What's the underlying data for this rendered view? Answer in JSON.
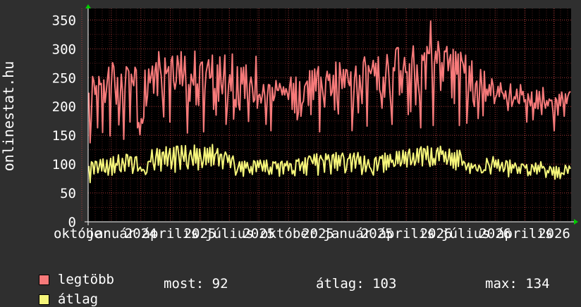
{
  "colors": {
    "background": "#2f2f2f",
    "plot_background": "#000000",
    "grid": "#b43c3c",
    "legtobb": "#f77a7a",
    "atlag": "#f5f57a",
    "axis_arrow": "#00cc00"
  },
  "chart_data": {
    "type": "line",
    "ylabel": "onlinestat.hu",
    "ylim": [
      0,
      370
    ],
    "yticks": [
      0,
      50,
      100,
      150,
      200,
      250,
      300,
      350
    ],
    "x_tick_labels": [
      "október",
      "január",
      "2024",
      "április",
      "2025",
      "július",
      "2025",
      "október",
      "2025",
      "január",
      "2025",
      "április",
      "2026",
      "július",
      "2026",
      "április",
      "2026"
    ],
    "grid": true,
    "series": [
      {
        "name": "legtöbb",
        "values": [
          224,
          137,
          181,
          252,
          244,
          221,
          236,
          163,
          252,
          238,
          240,
          155,
          246,
          207,
          227,
          249,
          268,
          149,
          235,
          276,
          269,
          233,
          204,
          250,
          168,
          205,
          256,
          225,
          143,
          230,
          269,
          266,
          261,
          173,
          256,
          244,
          236,
          268,
          263,
          163,
          172,
          151,
          179,
          171,
          182,
          263,
          201,
          219,
          265,
          241,
          254,
          270,
          223,
          262,
          276,
          219,
          295,
          269,
          254,
          217,
          182,
          284,
          257,
          262,
          269,
          173,
          279,
          287,
          244,
          230,
          244,
          288,
          271,
          239,
          295,
          236,
          257,
          287,
          229,
          154,
          238,
          209,
          256,
          245,
          237,
          296,
          203,
          239,
          202,
          270,
          276,
          277,
          156,
          228,
          259,
          271,
          281,
          249,
          251,
          289,
          195,
          231,
          185,
          272,
          209,
          286,
          239,
          222,
          253,
          289,
          169,
          200,
          237,
          255,
          227,
          291,
          178,
          212,
          199,
          269,
          204,
          194,
          267,
          239,
          268,
          214,
          272,
          224,
          174,
          239,
          251,
          234,
          208,
          212,
          287,
          197,
          219,
          221,
          206,
          219,
          238,
          219,
          169,
          214,
          238,
          237,
          158,
          233,
          210,
          218,
          245,
          228,
          228,
          240,
          231,
          220,
          234,
          220,
          231,
          224,
          212,
          235,
          251,
          195,
          240,
          189,
          251,
          177,
          190,
          243,
          183,
          205,
          209,
          235,
          240,
          244,
          202,
          262,
          186,
          262,
          212,
          265,
          227,
          259,
          269,
          156,
          251,
          233,
          216,
          199,
          247,
          261,
          245,
          256,
          219,
          225,
          254,
          194,
          277,
          211,
          187,
          276,
          255,
          231,
          264,
          233,
          264,
          263,
          243,
          236,
          260,
          158,
          203,
          249,
          270,
          228,
          189,
          254,
          231,
          205,
          277,
          286,
          267,
          166,
          271,
          262,
          257,
          267,
          280,
          253,
          275,
          229,
          286,
          229,
          221,
          197,
          251,
          216,
          255,
          290,
          270,
          235,
          205,
          169,
          267,
          262,
          298,
          302,
          302,
          220,
          262,
          224,
          266,
          285,
          259,
          260,
          186,
          274,
          191,
          282,
          305,
          261,
          203,
          272,
          240,
          218,
          163,
          289,
          280,
          293,
          230,
          304,
          292,
          292,
          348,
          270,
          167,
          273,
          296,
          275,
          313,
          293,
          228,
          276,
          244,
          296,
          295,
          304,
          262,
          281,
          290,
          215,
          299,
          205,
          295,
          256,
          291,
          167,
          294,
          280,
          274,
          258,
          289,
          171,
          216,
          270,
          227,
          279,
          210,
          200,
          239,
          244,
          179,
          216,
          264,
          235,
          184,
          261,
          209,
          230,
          219,
          238,
          219,
          248,
          237,
          205,
          215,
          221,
          235,
          217,
          241,
          225,
          222,
          213,
          227,
          211,
          193,
          219,
          239,
          200,
          208,
          217,
          213,
          230,
          208,
          205,
          238,
          220,
          226,
          208,
          212,
          173,
          222,
          211,
          201,
          225,
          177,
          206,
          197,
          228,
          196,
          226,
          207,
          186,
          233,
          208,
          197,
          210,
          201,
          213,
          210,
          211,
          192,
          158,
          215,
          211,
          185,
          221,
          201,
          225,
          211,
          183,
          222,
          205,
          218,
          224,
          226
        ],
        "color": "#f77a7a"
      },
      {
        "name": "átlag",
        "values": [
          97,
          68,
          104,
          102,
          83,
          105,
          104,
          85,
          95,
          108,
          88,
          109,
          88,
          86,
          107,
          81,
          95,
          110,
          81,
          113,
          85,
          101,
          98,
          116,
          90,
          87,
          110,
          101,
          88,
          117,
          116,
          96,
          113,
          112,
          84,
          94,
          112,
          113,
          88,
          92,
          95,
          88,
          91,
          89,
          82,
          86,
          104,
          105,
          104,
          125,
          102,
          90,
          112,
          127,
          98,
          125,
          88,
          120,
          121,
          100,
          130,
          97,
          116,
          127,
          92,
          107,
          129,
          86,
          131,
          131,
          113,
          91,
          132,
          115,
          105,
          132,
          98,
          92,
          115,
          124,
          110,
          98,
          133,
          102,
          127,
          90,
          126,
          111,
          94,
          106,
          129,
          99,
          127,
          103,
          129,
          97,
          134,
          99,
          117,
          119,
          127,
          97,
          117,
          117,
          92,
          113,
          121,
          116,
          103,
          115,
          94,
          109,
          114,
          99,
          81,
          87,
          95,
          104,
          87,
          104,
          79,
          105,
          93,
          103,
          92,
          85,
          96,
          82,
          106,
          104,
          87,
          106,
          94,
          107,
          99,
          88,
          106,
          87,
          107,
          91,
          82,
          95,
          83,
          104,
          102,
          104,
          92,
          101,
          79,
          103,
          105,
          83,
          101,
          97,
          105,
          89,
          101,
          100,
          83,
          89,
          80,
          107,
          105,
          109,
          89,
          99,
          104,
          84,
          111,
          81,
          108,
          114,
          113,
          106,
          101,
          117,
          98,
          118,
          81,
          108,
          115,
          109,
          106,
          86,
          118,
          108,
          116,
          104,
          83,
          115,
          117,
          93,
          120,
          89,
          115,
          97,
          114,
          119,
          111,
          85,
          91,
          109,
          110,
          118,
          87,
          112,
          119,
          93,
          110,
          120,
          100,
          113,
          82,
          93,
          114,
          87,
          98,
          108,
          95,
          92,
          86,
          81,
          109,
          112,
          89,
          100,
          113,
          110,
          115,
          86,
          119,
          90,
          115,
          95,
          117,
          103,
          107,
          96,
          98,
          122,
          101,
          122,
          97,
          103,
          124,
          101,
          121,
          95,
          119,
          126,
          99,
          104,
          119,
          98,
          106,
          127,
          103,
          125,
          130,
          97,
          127,
          126,
          108,
          131,
          105,
          96,
          128,
          98,
          110,
          99,
          123,
          128,
          106,
          131,
          117,
          123,
          104,
          121,
          100,
          108,
          126,
          98,
          119,
          93,
          120,
          90,
          124,
          96,
          124,
          115,
          98,
          105,
          102,
          90,
          97,
          102,
          84,
          101,
          93,
          97,
          99,
          90,
          88,
          98,
          94,
          85,
          86,
          90,
          89,
          110,
          103,
          97,
          83,
          101,
          113,
          95,
          107,
          93,
          108,
          88,
          97,
          103,
          87,
          92,
          106,
          104,
          78,
          107,
          85,
          99,
          93,
          102,
          96,
          84,
          95,
          84,
          100,
          100,
          97,
          93,
          99,
          80,
          87,
          81,
          99,
          96,
          87,
          102,
          83,
          98,
          87,
          104,
          93,
          96,
          92,
          77,
          89,
          85,
          96,
          93,
          81,
          95,
          74,
          96,
          77,
          94,
          75,
          85,
          84,
          82,
          98,
          93,
          84,
          97,
          92
        ],
        "color": "#f5f57a"
      }
    ]
  },
  "legend": {
    "legtobb_label": "legtöbb",
    "atlag_label": "átlag"
  },
  "stats": {
    "most": "most: 92",
    "atlag": "átlag: 103",
    "max": "max: 134"
  }
}
